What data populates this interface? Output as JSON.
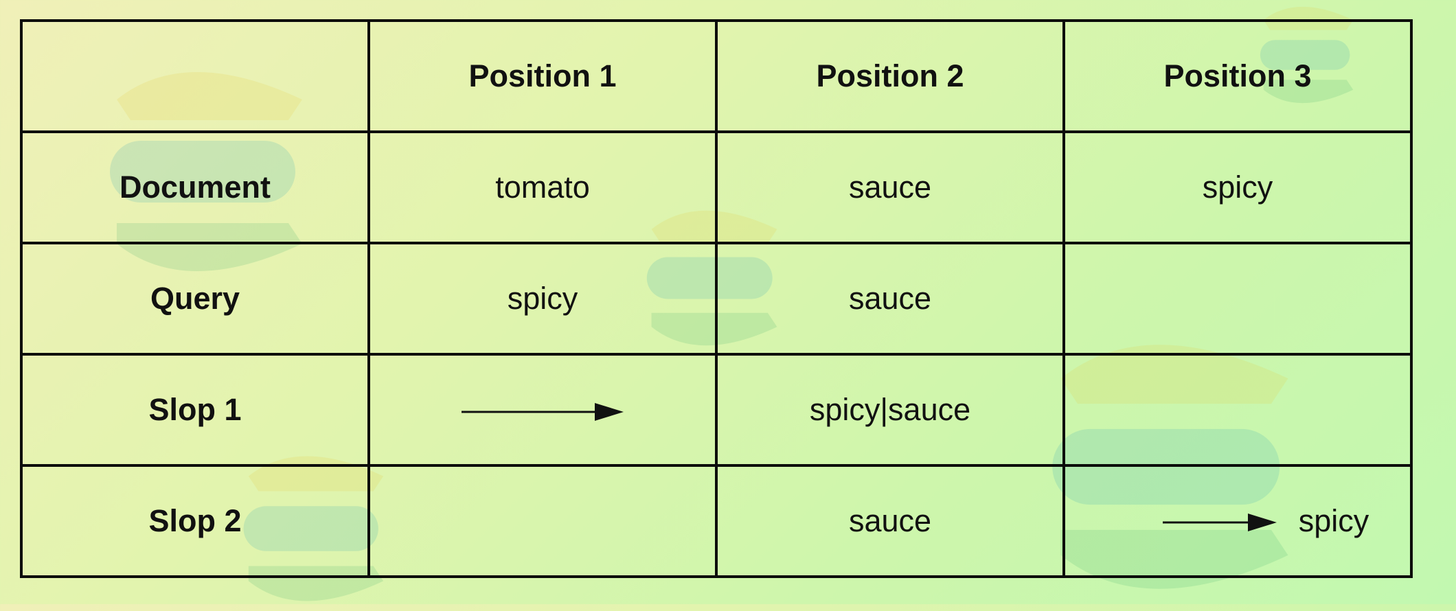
{
  "table": {
    "header": {
      "corner": "",
      "columns": [
        "Position 1",
        "Position 2",
        "Position 3"
      ]
    },
    "rows": [
      {
        "label": "Document",
        "cells": [
          "tomato",
          "sauce",
          "spicy"
        ]
      },
      {
        "label": "Query",
        "cells": [
          "spicy",
          "sauce",
          ""
        ]
      },
      {
        "label": "Slop 1",
        "cells": [
          "",
          "spicy|sauce",
          ""
        ]
      },
      {
        "label": "Slop 2",
        "cells": [
          "",
          "sauce",
          "spicy"
        ]
      }
    ],
    "arrows": [
      {
        "row": "Slop 1",
        "column": "Position 1",
        "direction": "right"
      },
      {
        "row": "Slop 2",
        "column": "Position 3",
        "direction": "right"
      }
    ]
  },
  "colors": {
    "background_start": "#f0f0b8",
    "background_end": "#c2f8b0",
    "border": "#0b0b0b",
    "text": "#111111"
  },
  "background_icons": [
    "elastic-logo-watermark"
  ]
}
